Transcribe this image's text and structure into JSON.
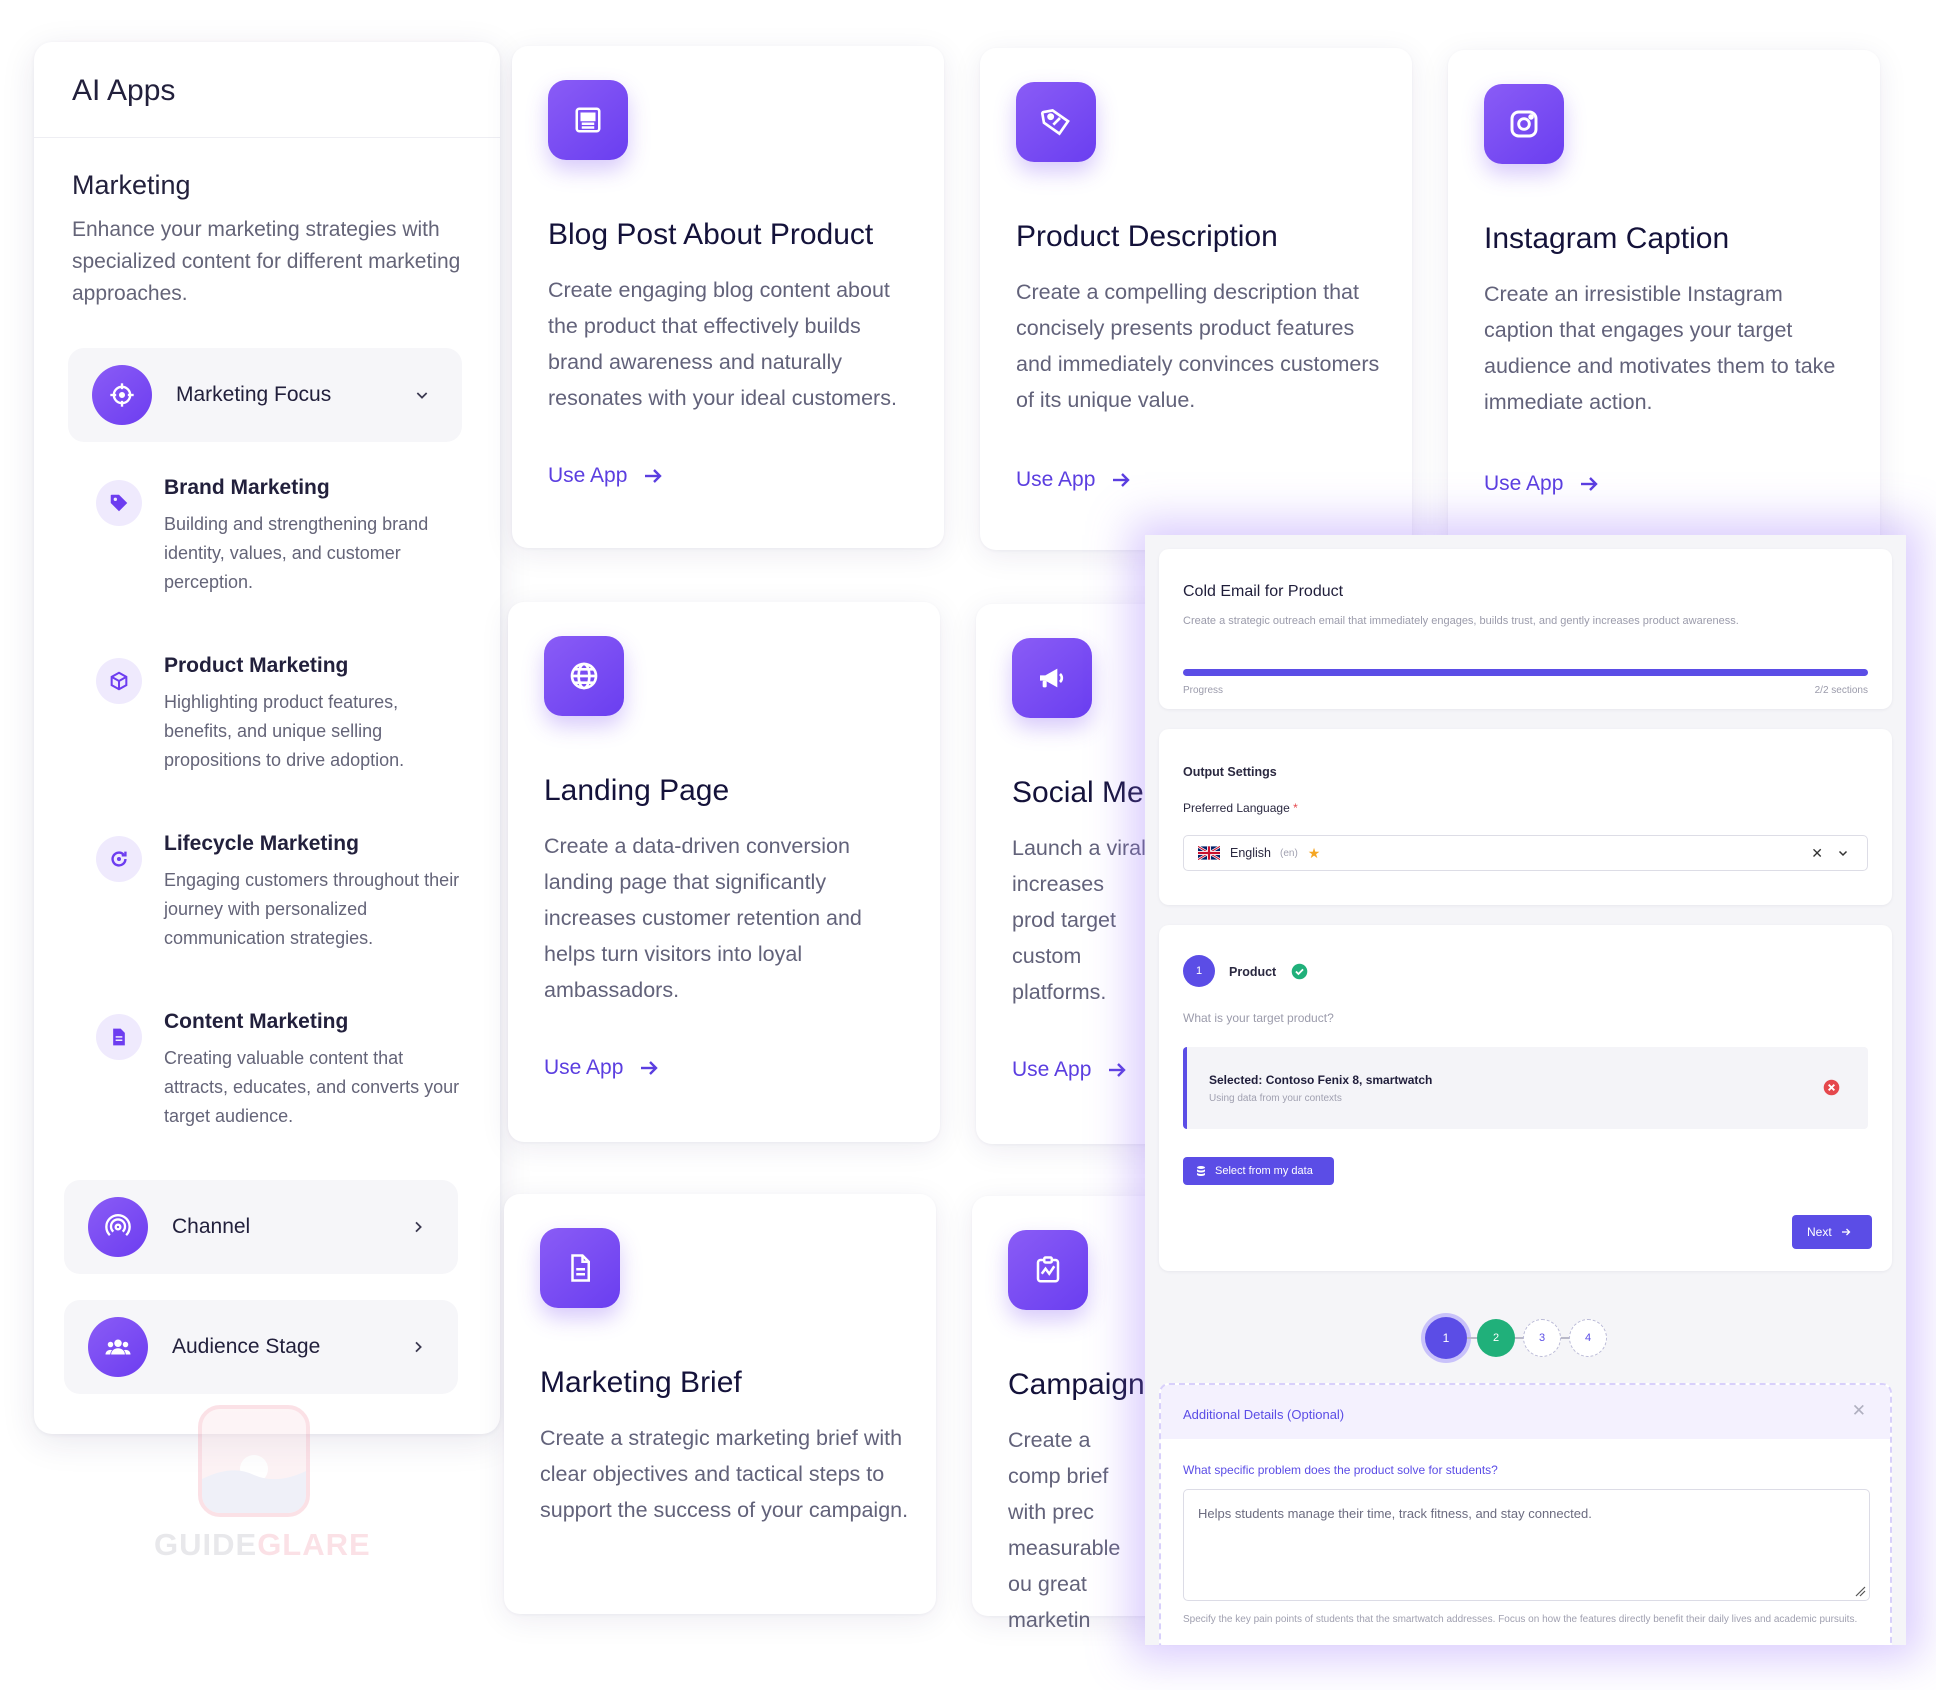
{
  "sidebar": {
    "title": "AI Apps",
    "section_title": "Marketing",
    "section_desc": "Enhance your marketing strategies with specialized content for different marketing approaches.",
    "focus": {
      "label": "Marketing Focus",
      "icon": "crosshair-icon"
    },
    "items": [
      {
        "title": "Brand Marketing",
        "desc": "Building and strengthening brand identity, values, and customer perception.",
        "icon": "tag-icon"
      },
      {
        "title": "Product Marketing",
        "desc": "Highlighting product features, benefits, and unique selling propositions to drive adoption.",
        "icon": "box-icon"
      },
      {
        "title": "Lifecycle Marketing",
        "desc": "Engaging customers throughout their journey with personalized communication strategies.",
        "icon": "cycle-icon"
      },
      {
        "title": "Content Marketing",
        "desc": "Creating valuable content that attracts, educates, and converts your target audience.",
        "icon": "document-icon"
      }
    ],
    "channel": {
      "label": "Channel",
      "icon": "broadcast-icon"
    },
    "audience": {
      "label": "Audience Stage",
      "icon": "users-icon"
    }
  },
  "watermark": {
    "text_a": "GUIDE",
    "text_b": "GLARE"
  },
  "cards": [
    {
      "title": "Blog Post About Product",
      "desc": "Create engaging blog content about the product that effectively builds brand awareness and naturally resonates with your ideal customers.",
      "cta": "Use App",
      "icon": "newspaper-icon"
    },
    {
      "title": "Product Description",
      "desc": "Create a compelling description that concisely presents product features and immediately convinces customers of its unique value.",
      "cta": "Use App",
      "icon": "tag-icon"
    },
    {
      "title": "Instagram Caption",
      "desc": "Create an irresistible Instagram caption that engages your target audience and motivates them to take immediate action.",
      "cta": "Use App",
      "icon": "instagram-icon"
    },
    {
      "title": "Landing Page",
      "desc": "Create a data-driven conversion landing page that significantly increases customer retention and helps turn visitors into loyal ambassadors.",
      "cta": "Use App",
      "icon": "globe-icon"
    },
    {
      "title": "Social Me",
      "desc": "Launch a viral increases prod target custom platforms.",
      "cta": "Use App",
      "icon": "megaphone-icon"
    },
    {
      "title": "Marketing Brief",
      "desc": "Create a strategic marketing brief with clear objectives and tactical steps to support the success of your campaign.",
      "cta": "",
      "icon": "file-text-icon"
    },
    {
      "title": "Campaign",
      "desc": "Create a comp brief with prec measurable ou great marketin",
      "cta": "",
      "icon": "clipboard-chart-icon"
    }
  ],
  "overlay": {
    "form_title": "Cold Email for Product",
    "form_desc": "Create a strategic outreach email that immediately engages, builds trust, and gently increases product awareness.",
    "progress_label": "Progress",
    "progress_count": "2/2 sections",
    "progress_fraction": 1.0,
    "output_title": "Output Settings",
    "lang_label": "Preferred Language",
    "required_mark": "*",
    "lang_value": "English",
    "lang_code": "(en)",
    "step_number": "1",
    "step_title": "Product",
    "question": "What is your target product?",
    "selected_text": "Selected: Contoso Fenix 8, smartwatch",
    "selected_sub": "Using data from your contexts",
    "select_btn": "Select from my data",
    "next_btn": "Next",
    "steps": [
      "1",
      "2",
      "3",
      "4"
    ],
    "extra_title": "Additional Details (Optional)",
    "extra_question": "What specific problem does the product solve for students?",
    "extra_answer": "Helps students manage their time, track fitness, and stay connected.",
    "extra_hint": "Specify the key pain points of students that the smartwatch addresses. Focus on how the features directly benefit their daily lives and academic pursuits.",
    "colors": {
      "accent": "#5b4de6",
      "success": "#20b07a",
      "danger": "#e5484d"
    }
  }
}
